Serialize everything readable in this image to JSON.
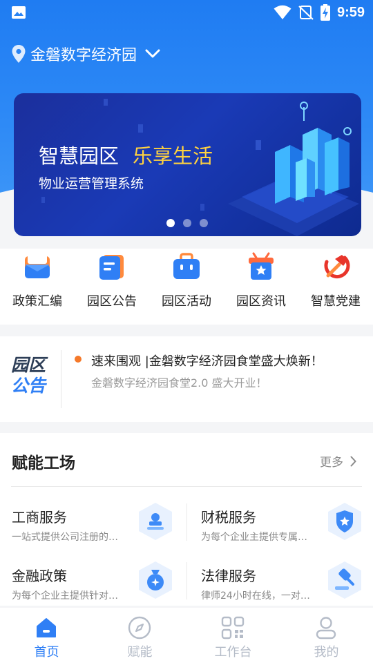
{
  "status_bar": {
    "time": "9:59",
    "icons": [
      "image-icon",
      "wifi-icon",
      "no-signal-icon",
      "battery-charging-icon"
    ]
  },
  "location": {
    "name": "金磐数字经济园",
    "icon": "location-pin-icon"
  },
  "banner": {
    "title_white": "智慧园区",
    "title_yellow": "乐享生活",
    "subtitle": "物业运营管理系统",
    "slide_count": 3,
    "active_slide": 1
  },
  "quick_menu": [
    {
      "label": "政策汇编",
      "icon": "policy-folder-icon"
    },
    {
      "label": "园区公告",
      "icon": "announcement-doc-icon"
    },
    {
      "label": "园区活动",
      "icon": "activity-bag-icon"
    },
    {
      "label": "园区资讯",
      "icon": "news-gift-icon"
    },
    {
      "label": "智慧党建",
      "icon": "party-emblem-icon"
    }
  ],
  "notice": {
    "logo_line1": "园区",
    "logo_line2": "公告",
    "headline": "速来围观 |金磐数字经济园食堂盛大焕新！",
    "subline": "金磐数字经济园食堂2.0 盛大开业！"
  },
  "workshop": {
    "title": "赋能工场",
    "more": "更多",
    "services": [
      {
        "name": "工商服务",
        "desc": "一站式提供公司注册的…",
        "icon": "business-stamp-icon"
      },
      {
        "name": "财税服务",
        "desc": "为每个企业主提供专属…",
        "icon": "tax-shield-icon"
      },
      {
        "name": "金融政策",
        "desc": "为每个企业主提供针对…",
        "icon": "finance-moneybag-icon"
      },
      {
        "name": "法律服务",
        "desc": "律师24小时在线，一对…",
        "icon": "legal-gavel-icon"
      }
    ]
  },
  "tabbar": {
    "tabs": [
      {
        "label": "首页",
        "icon": "home-icon",
        "active": true
      },
      {
        "label": "赋能",
        "icon": "compass-icon",
        "active": false
      },
      {
        "label": "工作台",
        "icon": "workbench-grid-icon",
        "active": false
      },
      {
        "label": "我的",
        "icon": "profile-icon",
        "active": false
      }
    ]
  },
  "colors": {
    "primary": "#2f7ff5",
    "accent_yellow": "#ffd23f",
    "bullet_orange": "#f5792a",
    "inactive_tab": "#b5bcc8"
  }
}
